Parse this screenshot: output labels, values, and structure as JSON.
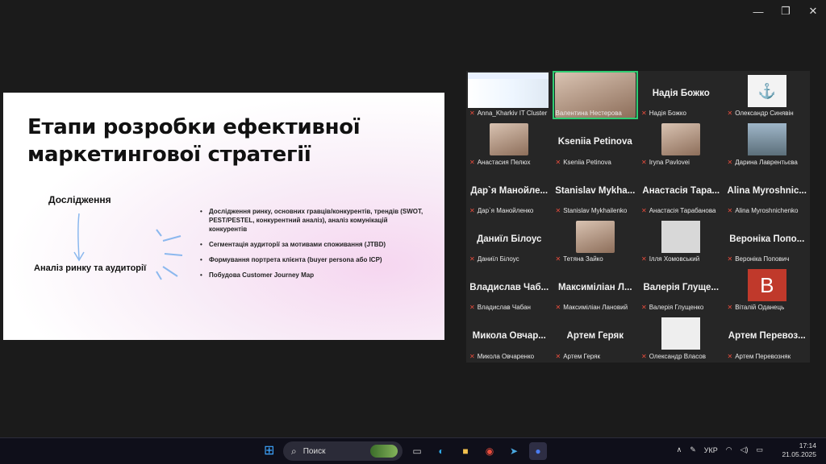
{
  "window": {
    "minimize": "—",
    "restore": "❐",
    "close": "✕"
  },
  "slide": {
    "title_line1": "Етапи розробки ефективної",
    "title_line2": "маркетингової стратегії",
    "stage1": "Дослідження",
    "stage2": "Аналіз ринку та аудиторії",
    "bullets": [
      "Дослідження ринку, основних гравців/конкурентів, трендів (SWOT, PEST/PESTEL, конкурентний аналіз), аналіз комунікацій конкурентів",
      "Сегментація аудиторії за мотивами споживання (JTBD)",
      "Формування портрета клієнта (buyer persona або ICP)",
      "Побудова Customer Journey Map"
    ]
  },
  "participants": [
    {
      "big": "",
      "name": "Anna_Kharkiv IT Cluster"
    },
    {
      "big": "",
      "name": "Валентина Нестерова"
    },
    {
      "big": "Надія Божко",
      "name": "Надія Божко"
    },
    {
      "big": "",
      "name": "Олександр Синявін"
    },
    {
      "big": "",
      "name": "Анастасия Пелюх"
    },
    {
      "big": "Kseniia Petinova",
      "name": "Kseniia Petinova"
    },
    {
      "big": "",
      "name": "Iryna Pavlovei"
    },
    {
      "big": "",
      "name": "Дарина Лаврентьєва"
    },
    {
      "big": "Дар`я Манойле...",
      "name": "Дар`я Манойленко"
    },
    {
      "big": "Stanislav Mykha...",
      "name": "Stanislav Mykhailenko"
    },
    {
      "big": "Анастасія Тара...",
      "name": "Анастасія Тарабанова"
    },
    {
      "big": "Alina Myroshnic...",
      "name": "Alina Myroshnichenko"
    },
    {
      "big": "Даниїл Білоус",
      "name": "Даниїл Білоус"
    },
    {
      "big": "",
      "name": "Тетяна Зайко"
    },
    {
      "big": "",
      "name": "Ілля Хомовський"
    },
    {
      "big": "Вероніка Попо...",
      "name": "Вероніка Попович"
    },
    {
      "big": "Владислав Чаб...",
      "name": "Владислав Чабан"
    },
    {
      "big": "Максиміліан Л...",
      "name": "Максиміліан Лановий"
    },
    {
      "big": "Валерія Глуще...",
      "name": "Валерія Глущенко"
    },
    {
      "big": "",
      "name": "Віталій Оданець",
      "avatar_letter": "В"
    },
    {
      "big": "Микола Овчар...",
      "name": "Микола Овчаренко"
    },
    {
      "big": "Артем Геряк",
      "name": "Артем Геряк"
    },
    {
      "big": "",
      "name": "Олександр Власов"
    },
    {
      "big": "Артем Перевоз...",
      "name": "Артем Перевозняк"
    }
  ],
  "taskbar": {
    "search_placeholder": "Поиск",
    "lang": "УКР",
    "time": "17:14",
    "date": "21.05.2025"
  }
}
